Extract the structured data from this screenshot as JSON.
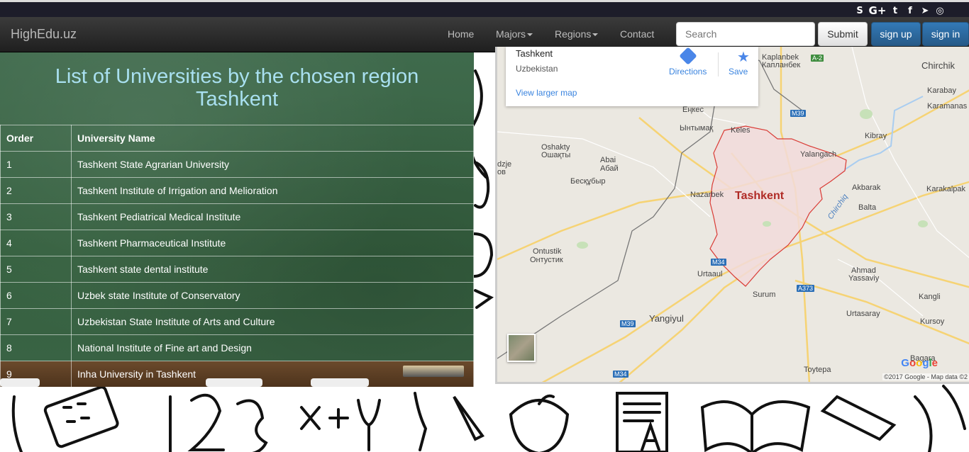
{
  "social": {
    "icons": [
      "skype-icon",
      "google-plus-icon",
      "twitter-icon",
      "facebook-icon",
      "telegram-icon",
      "instagram-icon"
    ],
    "glyphs": [
      "S",
      "G+",
      "t",
      "f",
      "➤",
      "◎"
    ]
  },
  "navbar": {
    "brand": "HighEdu.uz",
    "home": "Home",
    "majors": "Majors",
    "regions": "Regions",
    "contact": "Contact",
    "search_placeholder": "Search",
    "submit": "Submit",
    "signup": "sign up",
    "signin": "sign in"
  },
  "board": {
    "title_line1": "List of Universities by the chosen region",
    "title_line2": "Tashkent",
    "headers": [
      "Order",
      "University Name"
    ],
    "rows": [
      {
        "order": "1",
        "name": "Tashkent State Agrarian University"
      },
      {
        "order": "2",
        "name": "Tashkent Institute of Irrigation and Melioration"
      },
      {
        "order": "3",
        "name": "Tashkent Pediatrical Medical Institute"
      },
      {
        "order": "4",
        "name": "Tashkent Pharmaceutical Institute"
      },
      {
        "order": "5",
        "name": "Tashkent state dental institute"
      },
      {
        "order": "6",
        "name": "Uzbek state Institute of Conservatory"
      },
      {
        "order": "7",
        "name": "Uzbekistan State Institute of Arts and Culture"
      },
      {
        "order": "8",
        "name": "National Institute of Fine art and Design"
      },
      {
        "order": "9",
        "name": "Inha University in Tashkent"
      }
    ]
  },
  "map": {
    "card_title": "Tashkent",
    "card_subtitle": "Uzbekistan",
    "view_larger": "View larger map",
    "directions": "Directions",
    "save": "Save",
    "city": "Tashkent",
    "river": "Chirchiq",
    "google": "Google",
    "copyright": "©2017 Google - Map data ©2",
    "places": [
      "Kaplanbek",
      "Капланбек",
      "Chirchik",
      "Karabay",
      "Karamanas",
      "Еңкес",
      "Ынтымақ",
      "Keles",
      "Kibray",
      "Oshakty",
      "Ошақты",
      "Abai",
      "Абай",
      "Бесқұбыр",
      "Yalangach",
      "dzje",
      "ов",
      "Nazarbek",
      "Akbarak",
      "Karakalpak",
      "Balta",
      "Ontustik",
      "Онтустик",
      "Urtaaul",
      "Ahmad",
      "Yassaviy",
      "Surum",
      "Kangli",
      "Yangiyul",
      "Urtasaray",
      "Kursoy",
      "Bagara",
      "Toytepa"
    ],
    "shields": [
      "A-2",
      "M39",
      "M34",
      "A373",
      "M39",
      "M34"
    ]
  }
}
